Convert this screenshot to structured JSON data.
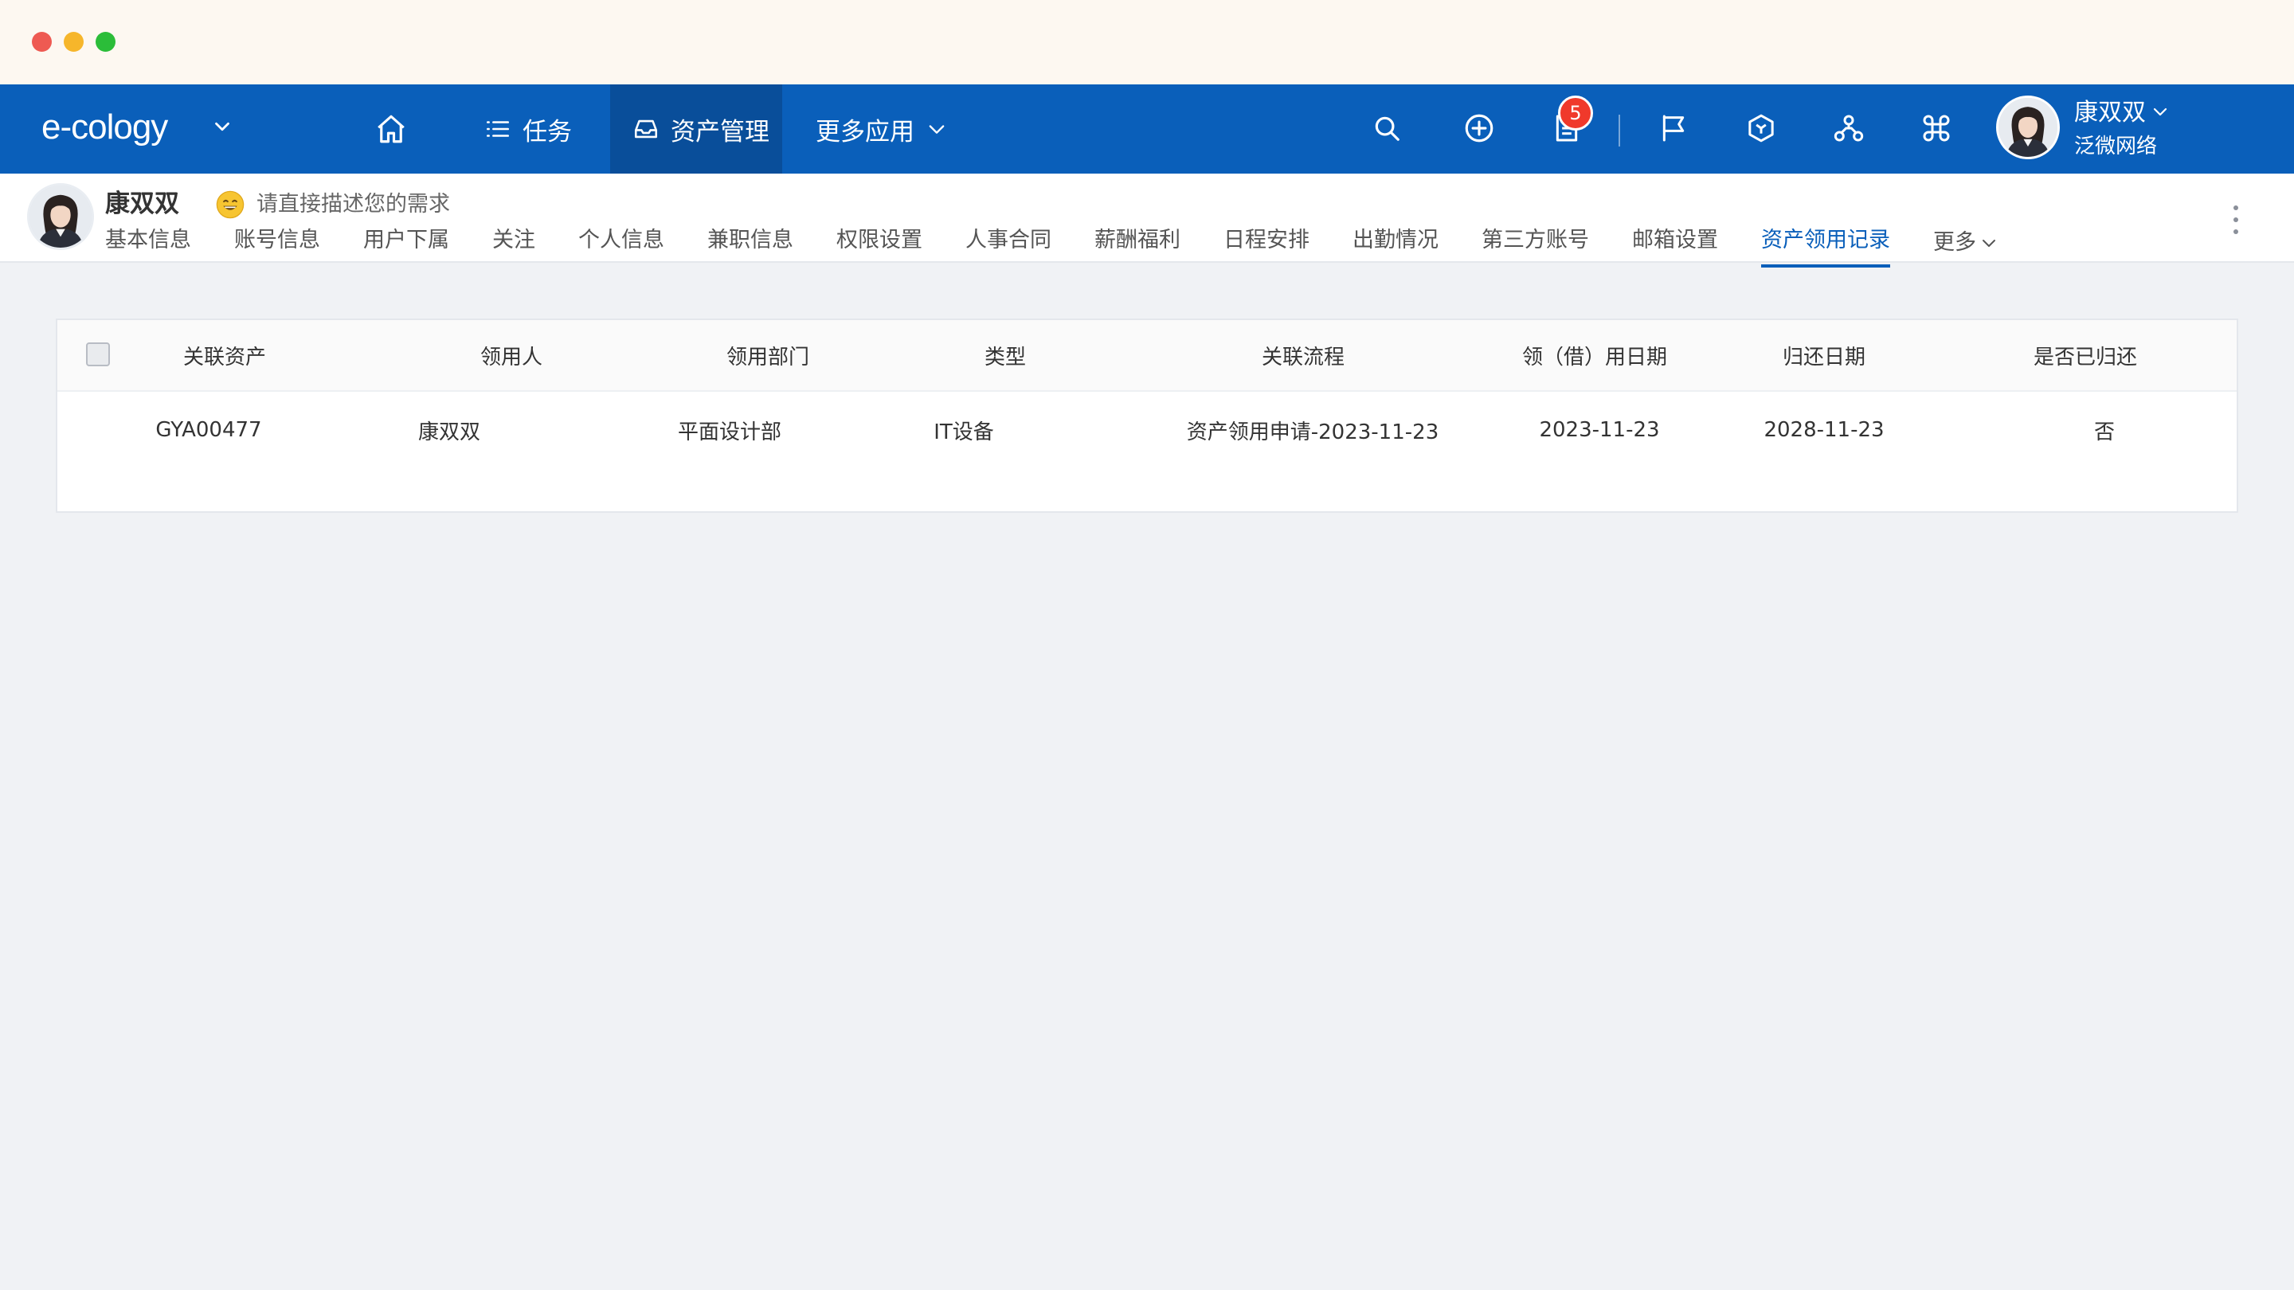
{
  "app": {
    "brand": "e-cology"
  },
  "topnav": {
    "items": [
      {
        "id": "home",
        "label": ""
      },
      {
        "id": "task",
        "label": "任务"
      },
      {
        "id": "asset",
        "label": "资产管理"
      },
      {
        "id": "more_apps",
        "label": "更多应用"
      }
    ],
    "notification_count": "5",
    "user": {
      "name": "康双双",
      "org": "泛微网络"
    },
    "icons": [
      "home-icon",
      "list-icon",
      "inbox-icon",
      "search-icon",
      "add-circle-icon",
      "document-icon",
      "flag-icon",
      "cube-icon",
      "org-chart-icon",
      "command-icon"
    ]
  },
  "profile": {
    "name": "康双双",
    "ai_hint": "请直接描述您的需求",
    "tabs": [
      {
        "label": "基本信息",
        "active": false
      },
      {
        "label": "账号信息",
        "active": false
      },
      {
        "label": "用户下属",
        "active": false
      },
      {
        "label": "关注",
        "active": false
      },
      {
        "label": "个人信息",
        "active": false
      },
      {
        "label": "兼职信息",
        "active": false
      },
      {
        "label": "权限设置",
        "active": false
      },
      {
        "label": "人事合同",
        "active": false
      },
      {
        "label": "薪酬福利",
        "active": false
      },
      {
        "label": "日程安排",
        "active": false
      },
      {
        "label": "出勤情况",
        "active": false
      },
      {
        "label": "第三方账号",
        "active": false
      },
      {
        "label": "邮箱设置",
        "active": false
      },
      {
        "label": "资产领用记录",
        "active": true
      }
    ],
    "more_label": "更多"
  },
  "table": {
    "columns": [
      "关联资产",
      "领用人",
      "领用部门",
      "类型",
      "关联流程",
      "领（借）用日期",
      "归还日期",
      "是否已归还"
    ],
    "rows": [
      [
        "GYA00477",
        "康双双",
        "平面设计部",
        "IT设备",
        "资产领用申请-2023-11-23",
        "2023-11-23",
        "2028-11-23",
        "否"
      ]
    ]
  },
  "colors": {
    "nav_bg": "#0a5fba",
    "nav_active_bg": "#094e9a",
    "accent": "#0a5fba",
    "badge": "#f0392b",
    "page_bg": "#f0f2f5"
  }
}
